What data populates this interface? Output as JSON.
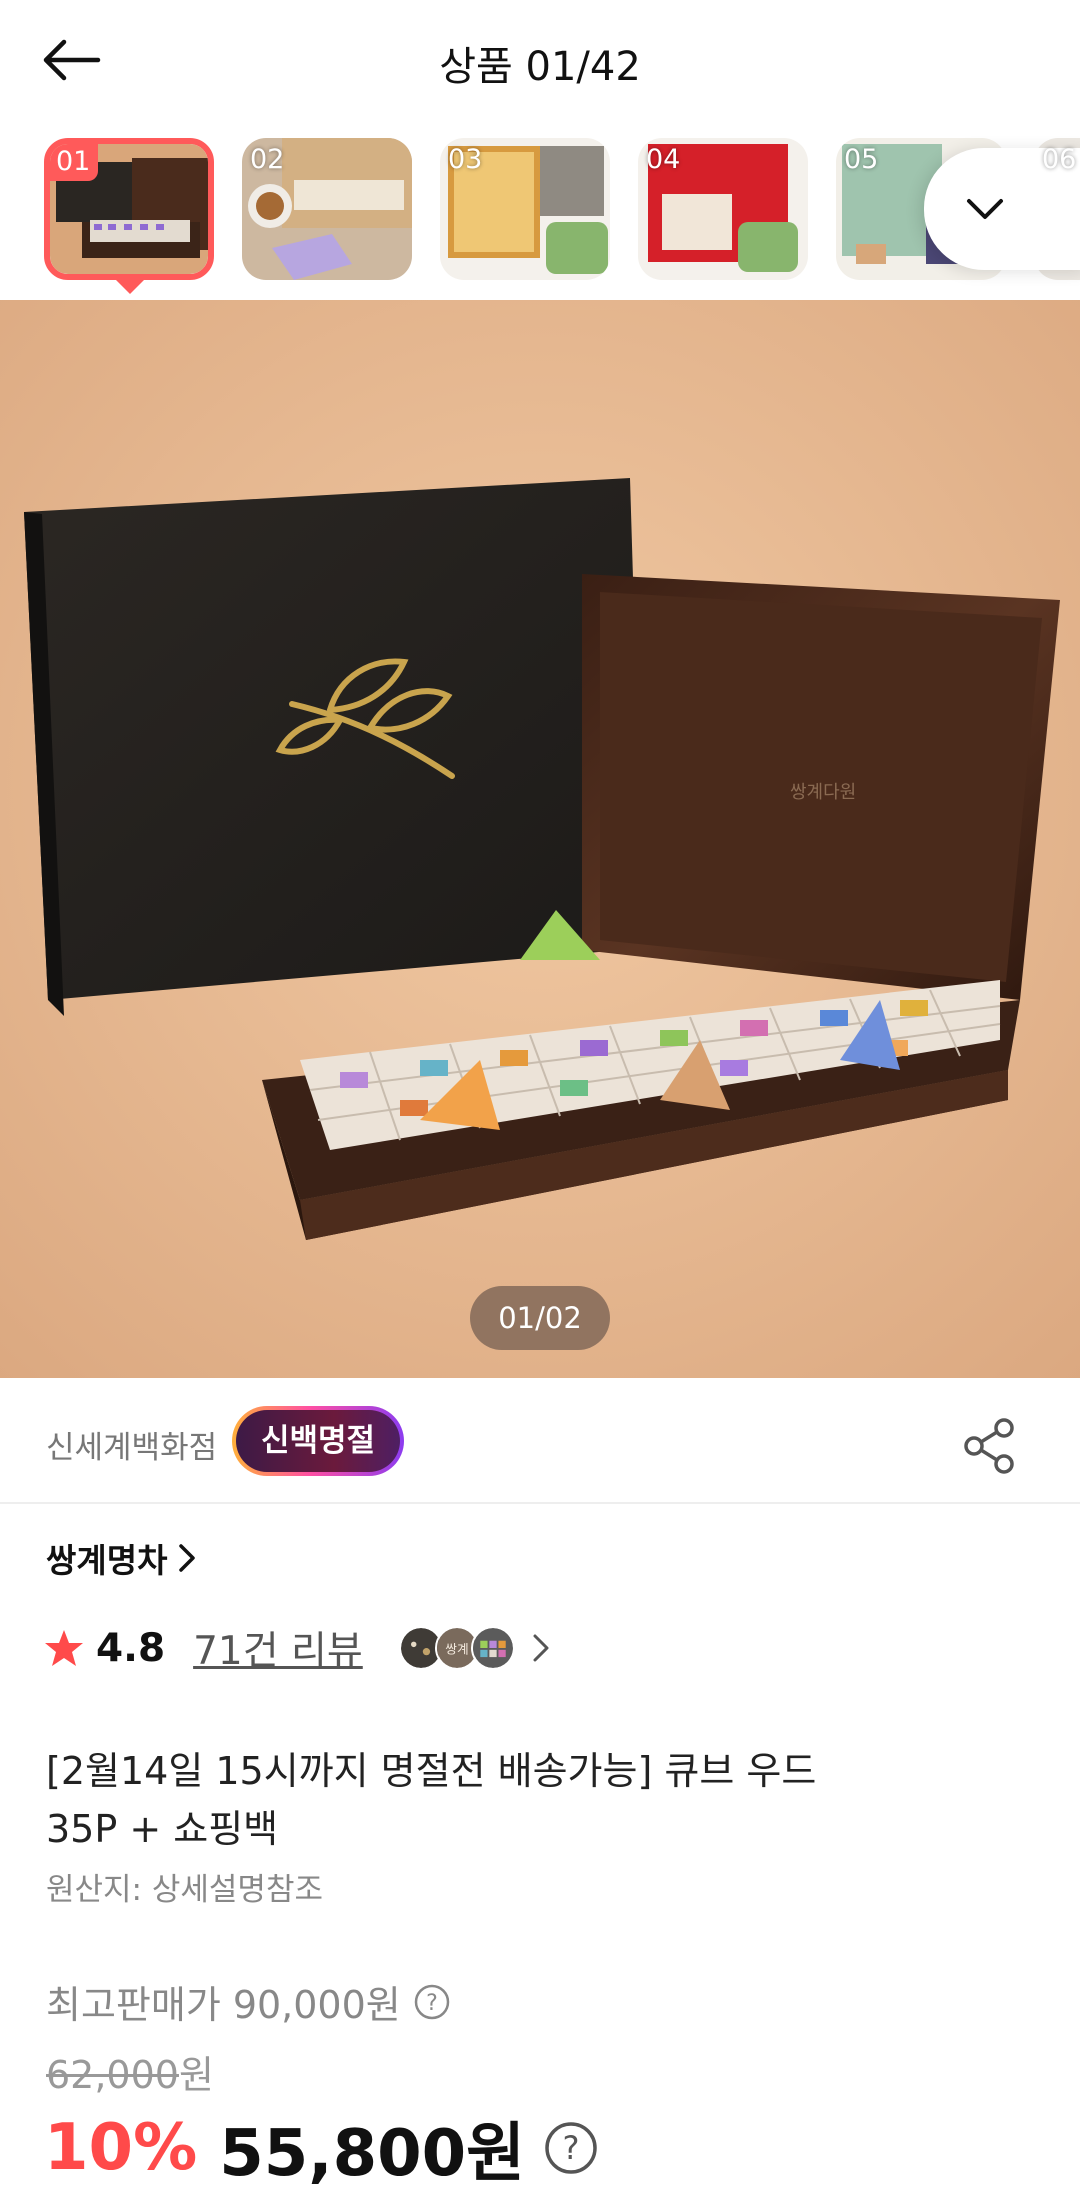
{
  "header": {
    "title": "상품 01/42"
  },
  "thumbnails": [
    {
      "num": "01",
      "active": true
    },
    {
      "num": "02",
      "active": false
    },
    {
      "num": "03",
      "active": false
    },
    {
      "num": "04",
      "active": false
    },
    {
      "num": "05",
      "active": false
    },
    {
      "num": "06",
      "active": false
    }
  ],
  "hero": {
    "counter": "01/02",
    "box_inscription": "쌍계다원"
  },
  "seller": {
    "store": "신세계백화점",
    "badge": "신백명절"
  },
  "brand": {
    "name": "쌍계명차"
  },
  "rating": {
    "score": "4.8",
    "reviews": "71건 리뷰",
    "avatar_label": "쌍계"
  },
  "product": {
    "title_line1": "[2월14일 15시까지 명절전 배송가능]  큐브 우드",
    "title_line2": "35P + 쇼핑백",
    "origin": "원산지: 상세설명참조"
  },
  "price": {
    "max_label": "최고판매가",
    "max_value": "90,000원",
    "original_number": "62,000",
    "original_unit": "원",
    "discount": "10%",
    "final": "55,800원"
  },
  "colors": {
    "accent_red": "#ff4a4a",
    "thumb_border": "#ff5a5a",
    "hero_background": "#e7b991"
  }
}
